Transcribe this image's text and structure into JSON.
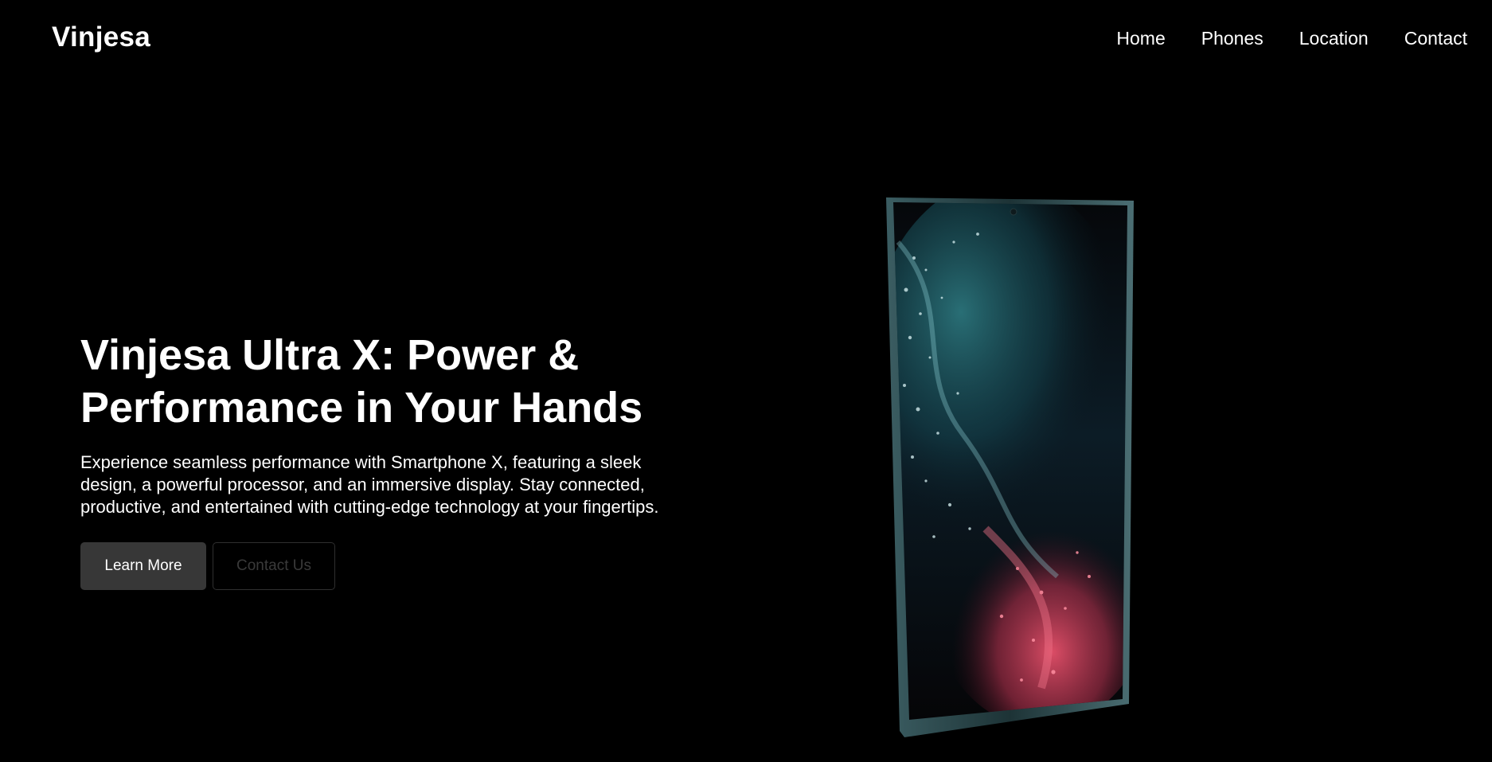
{
  "brand": {
    "name": "Vinjesa"
  },
  "nav": {
    "items": [
      {
        "label": "Home"
      },
      {
        "label": "Phones"
      },
      {
        "label": "Location"
      },
      {
        "label": "Contact"
      }
    ]
  },
  "hero": {
    "title_line1": "Vinjesa Ultra X: Power &",
    "title_line2": "Performance in Your Hands",
    "description": "Experience seamless performance with Smartphone X, featuring a sleek design, a powerful processor, and an immersive display. Stay connected, productive, and entertained with cutting-edge technology at your fingertips.",
    "primary_button": "Learn More",
    "secondary_button": "Contact Us"
  },
  "colors": {
    "background": "#000000",
    "text": "#ffffff",
    "primary_button_bg": "#373737",
    "secondary_button_text": "#3a3a3a",
    "phone_frame": "#2e4a4e",
    "wallpaper_teal": "#4fb3b8",
    "wallpaper_pink": "#e0435e"
  },
  "icons": {
    "phone_image": "smartphone-image"
  }
}
